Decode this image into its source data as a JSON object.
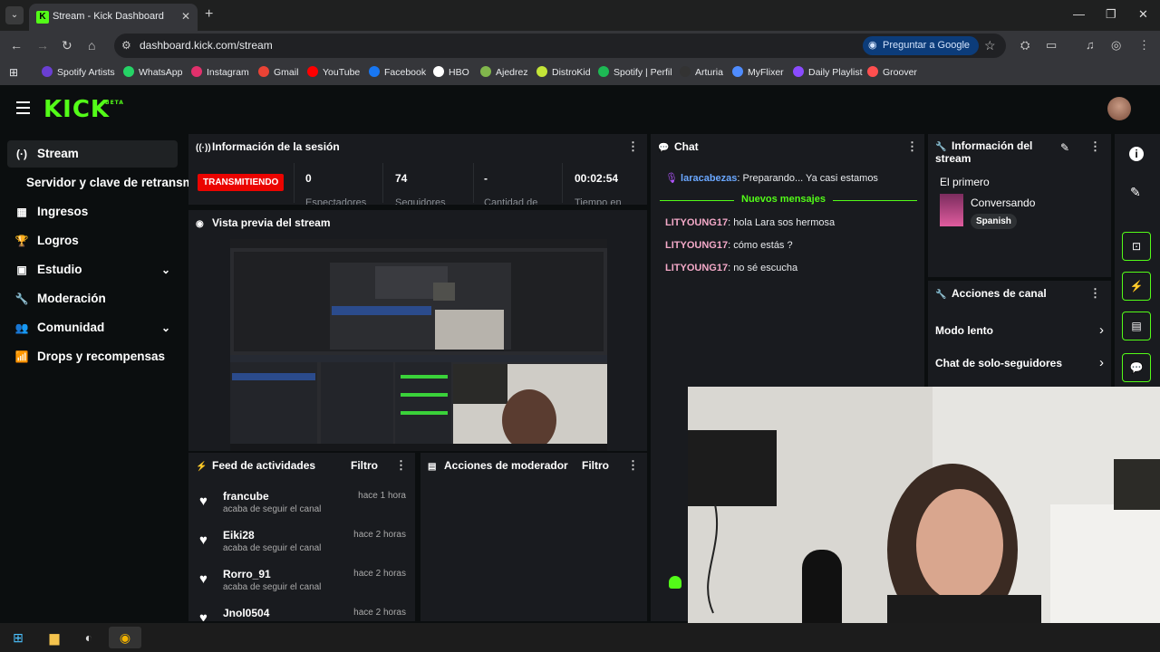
{
  "browser": {
    "tab_title": "Stream - Kick Dashboard",
    "tab_icon": "K",
    "url": "dashboard.kick.com/stream",
    "google_button": "Preguntar a Google",
    "bookmarks": [
      {
        "label": "Spotify Artists",
        "color": "#6a3fd3"
      },
      {
        "label": "WhatsApp",
        "color": "#25d366"
      },
      {
        "label": "Instagram",
        "color": "#e1306c"
      },
      {
        "label": "Gmail",
        "color": "#ea4335"
      },
      {
        "label": "YouTube",
        "color": "#ff0000"
      },
      {
        "label": "Facebook",
        "color": "#1877f2"
      },
      {
        "label": "HBO",
        "color": "#ffffff"
      },
      {
        "label": "Ajedrez",
        "color": "#81b64c"
      },
      {
        "label": "DistroKid",
        "color": "#c4e538"
      },
      {
        "label": "Spotify | Perfil",
        "color": "#1db954"
      },
      {
        "label": "Arturia",
        "color": "#333333"
      },
      {
        "label": "MyFlixer",
        "color": "#4f8cff"
      },
      {
        "label": "Daily Playlist",
        "color": "#8a4bff"
      },
      {
        "label": "Groover",
        "color": "#ff4f4f"
      }
    ]
  },
  "kick": {
    "logo": "KICK",
    "logo_sup": "BETA",
    "accent": "#53fc18",
    "sidebar": [
      {
        "label": "Stream",
        "icon": "(·)"
      },
      {
        "label": "Servidor y clave de retransmisión",
        "icon": ""
      },
      {
        "label": "Ingresos",
        "icon": "▦"
      },
      {
        "label": "Logros",
        "icon": "🏆"
      },
      {
        "label": "Estudio",
        "icon": "▣"
      },
      {
        "label": "Moderación",
        "icon": "🔧"
      },
      {
        "label": "Comunidad",
        "icon": "👥"
      },
      {
        "label": "Drops y recompensas",
        "icon": "📶"
      }
    ],
    "session": {
      "title": "Información de la sesión",
      "status": "TRANSMITIENDO",
      "stats": [
        {
          "value": "0",
          "label": "Espectadores"
        },
        {
          "value": "74",
          "label": "Seguidores"
        },
        {
          "value": "-",
          "label": "Cantidad de"
        },
        {
          "value": "00:02:54",
          "label": "Tiempo en"
        }
      ]
    },
    "preview": {
      "title": "Vista previa del stream"
    },
    "feed": {
      "title": "Feed de actividades",
      "filter": "Filtro",
      "items": [
        {
          "name": "francube",
          "time": "hace 1 hora",
          "sub": "acaba de seguir el canal"
        },
        {
          "name": "Eiki28",
          "time": "hace 2 horas",
          "sub": "acaba de seguir el canal"
        },
        {
          "name": "Rorro_91",
          "time": "hace 2 horas",
          "sub": "acaba de seguir el canal"
        },
        {
          "name": "Jnol0504",
          "time": "hace 2 horas",
          "sub": ""
        }
      ]
    },
    "modactions": {
      "title": "Acciones de moderador",
      "filter": "Filtro"
    },
    "chat": {
      "title": "Chat",
      "first_user": "laracabezas",
      "first_msg": ": Preparando... Ya casi estamos",
      "divider": "Nuevos mensajes",
      "messages": [
        {
          "user": "LITYOUNG17",
          "text": ": hola Lara sos hermosa"
        },
        {
          "user": "LITYOUNG17",
          "text": ": cómo estás ?"
        },
        {
          "user": "LITYOUNG17",
          "text": ": no sé escucha"
        }
      ]
    },
    "stream_info": {
      "title": "Información del stream",
      "stream_title": "El primero",
      "category": "Conversando",
      "language": "Spanish"
    },
    "channel_actions": {
      "title": "Acciones de canal",
      "items": [
        "Modo lento",
        "Chat de solo-seguidores"
      ]
    }
  }
}
